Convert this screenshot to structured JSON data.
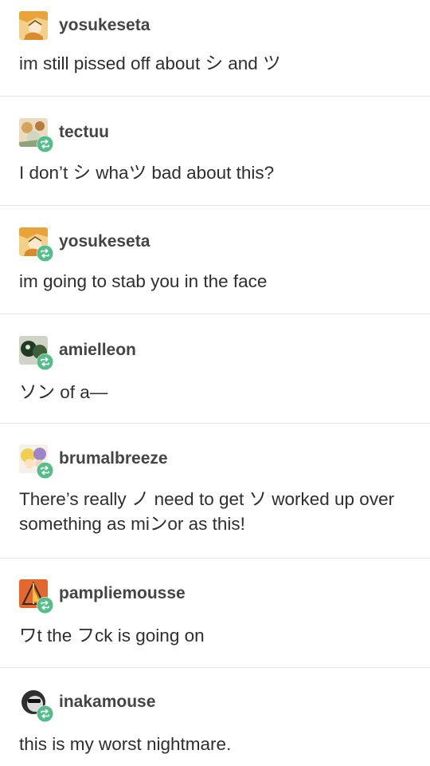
{
  "posts": [
    {
      "username": "yosukeseta",
      "text": "im still pissed off about シ and ツ",
      "reblogged": false,
      "avatar": "avatar-yellow-haired-anime-character"
    },
    {
      "username": "tectuu",
      "text": "I don’t シ whaツ bad about this?",
      "reblogged": true,
      "avatar": "avatar-anime-character-group"
    },
    {
      "username": "yosukeseta",
      "text": "im going to stab you in the face",
      "reblogged": true,
      "avatar": "avatar-yellow-haired-anime-character"
    },
    {
      "username": "amielleon",
      "text": "ソン of a—",
      "reblogged": true,
      "avatar": "avatar-dark-green-figure"
    },
    {
      "username": "brumalbreeze",
      "text": "There’s really ノ need to get ソ worked up over something as miンor as this!",
      "reblogged": true,
      "avatar": "avatar-blonde-purple-characters"
    },
    {
      "username": "pampliemousse",
      "text": "ワt the フck is going on",
      "reblogged": true,
      "avatar": "avatar-orange-triangle-logo"
    },
    {
      "username": "inakamouse",
      "text": "this is my worst nightmare.",
      "reblogged": true,
      "avatar": "avatar-black-white-sunglasses-character"
    }
  ],
  "colors": {
    "reblog_badge": "#56bc8a",
    "divider": "#e4e4e4",
    "username": "#444444",
    "text": "#2e2e2e"
  }
}
